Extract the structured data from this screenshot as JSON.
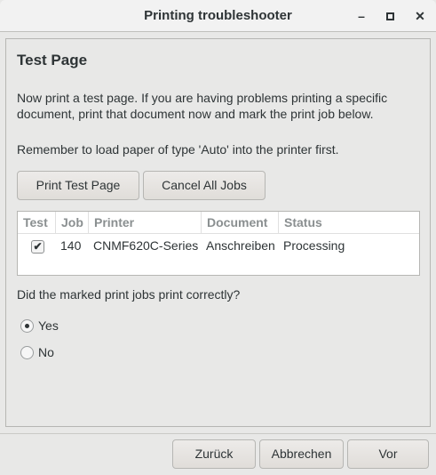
{
  "window": {
    "title": "Printing troubleshooter",
    "controls": [
      "minimize",
      "maximize",
      "close"
    ]
  },
  "page": {
    "heading": "Test Page",
    "intro_line1": "Now print a test page.  If you are having problems printing a specific",
    "intro_line2": "document, print that document now and mark the print job below.",
    "paper_note": "Remember to load paper of type 'Auto' into the printer first.",
    "print_test_page": "Print Test Page",
    "cancel_all_jobs": "Cancel All Jobs",
    "table": {
      "headers": [
        "Test",
        "Job",
        "Printer",
        "Document",
        "Status"
      ],
      "rows": [
        {
          "test": true,
          "job": "140",
          "printer": "CNMF620C-Series",
          "document": "Anschreiben",
          "status": "Processing"
        }
      ]
    },
    "question": "Did the marked print jobs print correctly?",
    "options": [
      {
        "label": "Yes",
        "selected": true
      },
      {
        "label": "No",
        "selected": false
      }
    ]
  },
  "footer": {
    "back": "Zurück",
    "cancel": "Abbrechen",
    "forward": "Vor"
  }
}
